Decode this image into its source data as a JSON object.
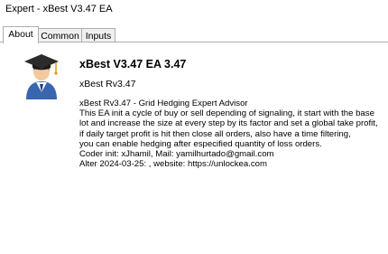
{
  "window": {
    "title": "Expert - xBest V3.47 EA"
  },
  "tabs": [
    {
      "label": "About",
      "active": true
    },
    {
      "label": "Common",
      "active": false
    },
    {
      "label": "Inputs",
      "active": false
    }
  ],
  "about": {
    "icon": "user-graduation-cap-icon",
    "name": "xBest V3.47 EA 3.47",
    "version_line": "xBest   Rv3.47",
    "description_lines": [
      "xBest Rv3.47 - Grid Hedging Expert Advisor",
      "This EA init a cycle of buy or sell depending of signaling, it start with the base",
      "lot and increase the size at every step by its factor and set a global take profit,",
      "if daily target profit is hit then close all orders, also have a time filtering,",
      "you can enable hedging after especified quantity of loss orders.",
      "Coder init: xJhamil, Mail: yamilhurtado@gmail.com",
      "Alter  2024-03-25: , website: https://unlockea.com"
    ]
  }
}
